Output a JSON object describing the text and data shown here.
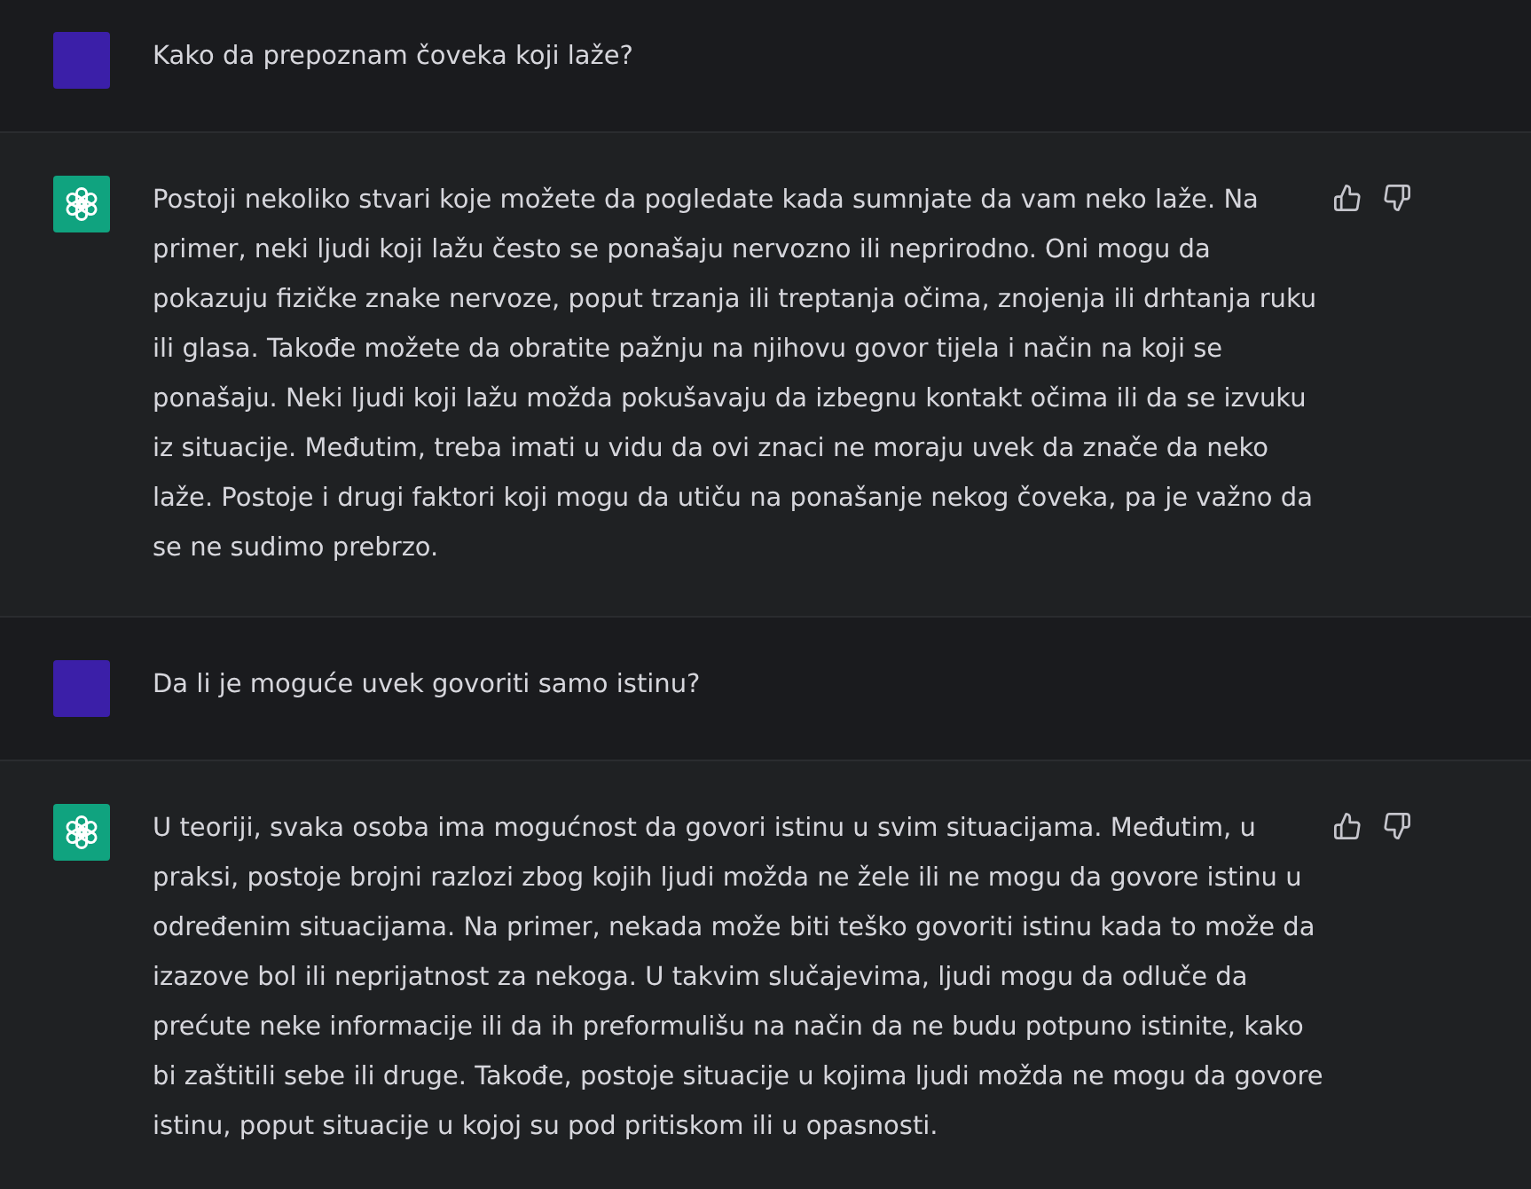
{
  "messages": [
    {
      "kind": "user",
      "text": "Kako da prepoznam čoveka koji laže?"
    },
    {
      "kind": "assistant",
      "text": "Postoji nekoliko stvari koje možete da pogledate kada sumnjate da vam neko laže. Na primer, neki ljudi koji lažu često se ponašaju nervozno ili neprirodno. Oni mogu da pokazuju fizičke znake nervoze, poput trzanja ili treptanja očima, znojenja ili drhtanja ruku ili glasa. Takođe možete da obratite pažnju na njihovu govor tijela i način na koji se ponašaju. Neki ljudi koji lažu možda pokušavaju da izbegnu kontakt očima ili da se izvuku iz situacije. Međutim, treba imati u vidu da ovi znaci ne moraju uvek da znače da neko laže. Postoje i drugi faktori koji mogu da utiču na ponašanje nekog čoveka, pa je važno da se ne sudimo prebrzo."
    },
    {
      "kind": "user",
      "text": "Da li je moguće uvek govoriti samo istinu?"
    },
    {
      "kind": "assistant",
      "text": "U teoriji, svaka osoba ima mogućnost da govori istinu u svim situacijama. Međutim, u praksi, postoje brojni razlozi zbog kojih ljudi možda ne žele ili ne mogu da govore istinu u određenim situacijama. Na primer, nekada može biti teško govoriti istinu kada to može da izazove bol ili neprijatnost za nekoga. U takvim slučajevima, ljudi mogu da odluče da prećute neke informacije ili da ih preformulišu na način da ne budu potpuno istinite, kako bi zaštitili sebe ili druge. Takođe, postoje situacije u kojima ljudi možda ne mogu da govore istinu, poput situacije u kojoj su pod pritiskom ili u opasnosti."
    }
  ]
}
